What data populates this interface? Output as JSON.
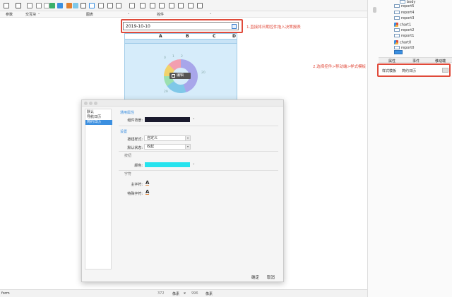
{
  "toolbar": {
    "icons": [
      "new-icon",
      "open-icon",
      "save-icon",
      "undo-icon",
      "redo-icon",
      "pie-chart-icon",
      "bar-chart-icon",
      "line-chart-icon",
      "area-chart-icon",
      "map-icon",
      "gauge-icon",
      "globe-icon",
      "grid-icon",
      "form-icon",
      "widget-icon",
      "text-icon",
      "image-icon",
      "table-icon",
      "calendar-icon",
      "button-icon",
      "tree-icon",
      "list-icon"
    ],
    "sections": {
      "params": "参数",
      "interactive_block": "交互块",
      "chart": "图表",
      "widget": "控件"
    }
  },
  "canvas": {
    "date_value": "2019-10-10",
    "note1": "1.直接将日期控件拖入决策报表",
    "note2": "2.选择控件>移动端>样式模板",
    "report_headers": [
      "A",
      "B",
      "C",
      "D"
    ],
    "edit_label": "编辑",
    "donut_labels": [
      "0",
      "1",
      "2",
      "20",
      "29"
    ]
  },
  "dialog": {
    "list": [
      "默认",
      "导航日历",
      "简约日历"
    ],
    "selected_index": 2,
    "section_general": "通用属性",
    "widget_bg_label": "组件背景:",
    "section_settings": "设置",
    "button_style_label": "按钮样式:",
    "button_style_value": "自定义",
    "default_state_label": "默认状态:",
    "default_state_value": "收起",
    "sub_button": "按钮",
    "color_label": "颜色:",
    "sub_font": "字符",
    "main_font_label": "主字符:",
    "special_font_label": "特殊字符:",
    "font_glyph": "A",
    "ok": "确定",
    "cancel": "取消",
    "colors": {
      "widget_bg": "#1a1a2e",
      "button_color": "#26e3ee"
    }
  },
  "status": {
    "form_label": "form",
    "width": "372",
    "unit1": "像素",
    "x": "x",
    "height": "996",
    "unit2": "像素"
  },
  "right_panel": {
    "tree": [
      {
        "label": "body",
        "icon": "folder"
      },
      {
        "label": "report5",
        "icon": "report"
      },
      {
        "label": "report4",
        "icon": "report"
      },
      {
        "label": "report3",
        "icon": "report"
      },
      {
        "label": "chart1",
        "icon": "chart"
      },
      {
        "label": "report2",
        "icon": "report"
      },
      {
        "label": "report1",
        "icon": "report"
      },
      {
        "label": "chart0",
        "icon": "chart"
      },
      {
        "label": "report0",
        "icon": "report"
      }
    ],
    "tabs": [
      "属性",
      "事件",
      "移动端"
    ],
    "active_tab": "移动端",
    "prop_label": "样式模板",
    "prop_value": "简约日历"
  }
}
